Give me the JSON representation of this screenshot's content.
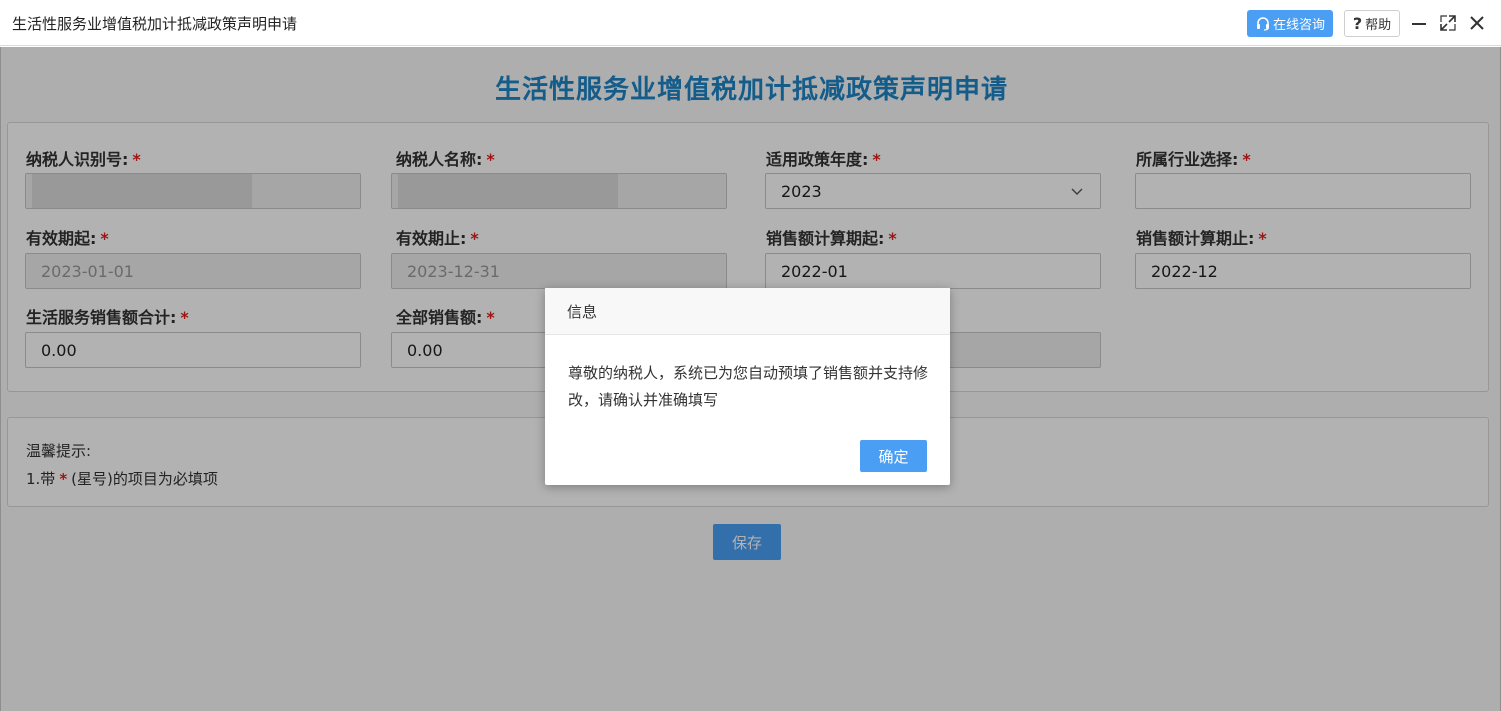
{
  "window": {
    "title": "生活性服务业增值税加计抵减政策声明申请",
    "consult_label": "在线咨询",
    "help_label": "帮助"
  },
  "page": {
    "title": "生活性服务业增值税加计抵减政策声明申请"
  },
  "form": {
    "taxpayer_id": {
      "label": "纳税人识别号:",
      "value": ""
    },
    "taxpayer_name": {
      "label": "纳税人名称:",
      "value": ""
    },
    "policy_year": {
      "label": "适用政策年度:",
      "value": "2023"
    },
    "industry": {
      "label": "所属行业选择:",
      "value": ""
    },
    "valid_from": {
      "label": "有效期起:",
      "value": "2023-01-01"
    },
    "valid_to": {
      "label": "有效期止:",
      "value": "2023-12-31"
    },
    "sales_period_from": {
      "label": "销售额计算期起:",
      "value": "2022-01"
    },
    "sales_period_to": {
      "label": "销售额计算期止:",
      "value": "2022-12"
    },
    "life_service_sales": {
      "label": "生活服务销售额合计:",
      "value": "0.00"
    },
    "total_sales": {
      "label": "全部销售额:",
      "value": "0.00"
    },
    "required_mark": "*"
  },
  "tips": {
    "title": "温馨提示:",
    "line1_prefix": "1.带",
    "line1_star": "*",
    "line1_suffix": "(星号)的项目为必填项"
  },
  "actions": {
    "save_label": "保存"
  },
  "dialog": {
    "title": "信息",
    "message": "尊敬的纳税人，系统已为您自动预填了销售额并支持修改，请确认并准确填写",
    "ok_label": "确定"
  },
  "colors": {
    "accent": "#4a9ff5",
    "title_blue": "#1e84c6",
    "required_red": "#e02020"
  }
}
